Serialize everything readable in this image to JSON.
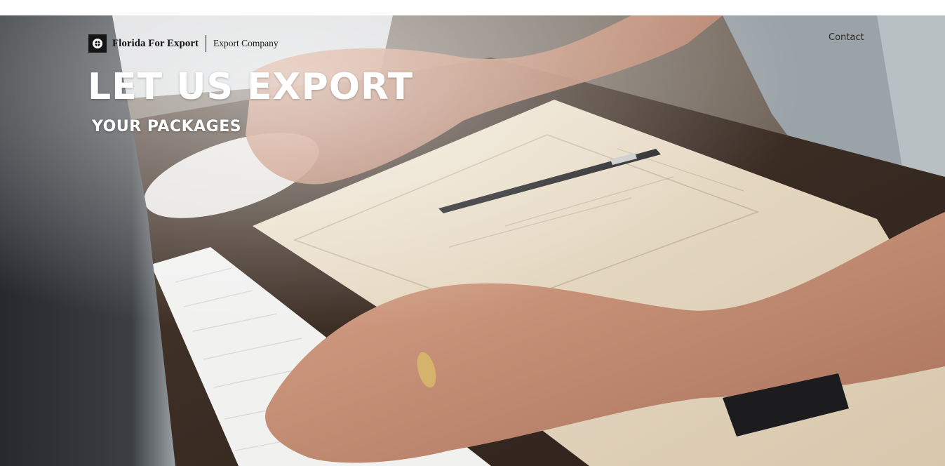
{
  "header": {
    "brand_name": "Florida For Export",
    "brand_tagline": "Export Company",
    "logo_icon": "globe-logo-icon",
    "nav": {
      "contact_label": "Contact"
    }
  },
  "hero": {
    "headline": "LET US EXPORT",
    "subheadline": "YOUR PACKAGES",
    "background_image": "photo-hands-typing-keyboard-notebook-pen-icon"
  },
  "colors": {
    "heading_text": "#ffffff",
    "brand_text": "#151515",
    "nav_text": "#2e2a26"
  }
}
